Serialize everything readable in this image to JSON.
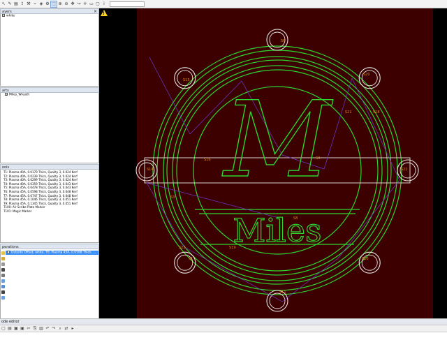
{
  "toolbar": {
    "buttons": [
      {
        "name": "select-icon",
        "glyph": "↖"
      },
      {
        "name": "node-edit-icon",
        "glyph": "✎"
      },
      {
        "name": "folder-icon",
        "glyph": "▤"
      },
      {
        "name": "export-icon",
        "glyph": "⇪"
      },
      {
        "name": "tool-icon",
        "glyph": "⚒"
      },
      {
        "name": "measure-icon",
        "glyph": "⌁"
      },
      {
        "name": "layers-icon",
        "glyph": "◈"
      },
      {
        "name": "gear-icon",
        "glyph": "⚙"
      },
      {
        "name": "pointer-icon",
        "glyph": "⬚",
        "active": true
      },
      {
        "name": "zoom-in-icon",
        "glyph": "⊕"
      },
      {
        "name": "zoom-out-icon",
        "glyph": "⊖"
      },
      {
        "name": "pan-icon",
        "glyph": "✥"
      },
      {
        "name": "lead-icon",
        "glyph": "↪"
      },
      {
        "name": "crosshair-icon",
        "glyph": "✛"
      },
      {
        "name": "rect-icon",
        "glyph": "▭"
      },
      {
        "name": "frame-icon",
        "glyph": "▢"
      },
      {
        "name": "info-icon",
        "glyph": "ⅰ"
      }
    ]
  },
  "panels": {
    "layers": {
      "title": "ayers",
      "items": [
        "white"
      ]
    },
    "parts": {
      "title": "arts",
      "items": [
        "Miles_Wreath"
      ]
    },
    "tools": {
      "title": "ools",
      "items": [
        "T1: Plasma 40A, 0.0179 Thick, Quality 3, 0.024 Kerf",
        "T2: Plasma 40A, 0.0239 Thick, Quality 3, 0.024 Kerf",
        "T3: Plasma 40A, 0.0299 Thick, Quality 3, 0.024 Kerf",
        "T4: Plasma 40A, 0.0359 Thick, Quality 3, 0.043 Kerf",
        "T5: Plasma 45A, 0.0478 Thick, Quality 3, 0.043 Kerf",
        "T6: Plasma 45A, 0.0598 Thick, Quality 3, 0.048 Kerf",
        "T7: Plasma 45A, 0.0747 Thick, Quality 3, 0.048 Kerf",
        "T8: Plasma 45A, 0.1046 Thick, Quality 3, 0.051 Kerf",
        "T9: Plasma 45A, 0.1345 Thick, Quality 3, 0.051 Kerf",
        "T100: Air Scribe Plate Marker",
        "T101: Magic Marker"
      ]
    },
    "operations": {
      "title": "perations",
      "items": [
        "Outside Offset, white, T6: Plasma 45A, 0.0598 Thick, ..."
      ]
    }
  },
  "canvas": {
    "logo_big": "M",
    "logo_word": "Miles",
    "point_labels": [
      "S6",
      "S20",
      "S15",
      "S22",
      "S14",
      "S16",
      "S4",
      "S3",
      "S8",
      "S23",
      "S1",
      "S10",
      "S11",
      "S19",
      "S18",
      "S21"
    ],
    "colors": {
      "sheet": "#3c0000",
      "profile": "#2fd52f",
      "parts": "#e8e8e8",
      "rapid": "#6a3bd0",
      "label": "#d98a2a"
    }
  },
  "code_editor": {
    "title": "ode editor"
  }
}
